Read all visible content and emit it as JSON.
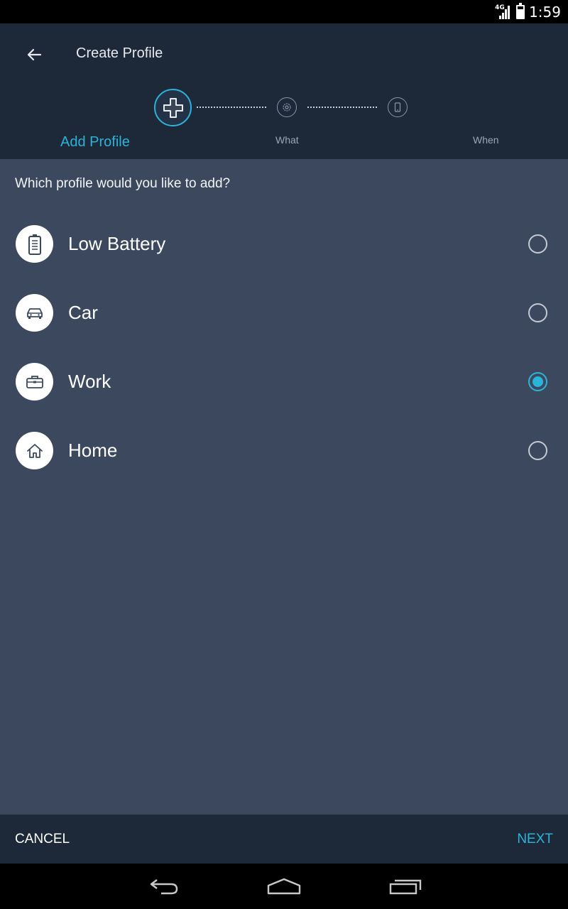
{
  "status_bar": {
    "network": "4G",
    "time": "1:59",
    "icons": [
      "signal-icon",
      "battery-icon"
    ]
  },
  "header": {
    "title": "Create Profile",
    "back_icon": "back-arrow-icon",
    "steps": [
      {
        "label": "Add Profile",
        "icon": "plus-icon",
        "active": true
      },
      {
        "label": "What",
        "icon": "gear-icon",
        "active": false
      },
      {
        "label": "When",
        "icon": "phone-icon",
        "active": false
      }
    ]
  },
  "main": {
    "question": "Which profile would you like to add?",
    "options": [
      {
        "label": "Low Battery",
        "icon": "battery-icon",
        "selected": false
      },
      {
        "label": "Car",
        "icon": "car-icon",
        "selected": false
      },
      {
        "label": "Work",
        "icon": "briefcase-icon",
        "selected": true
      },
      {
        "label": "Home",
        "icon": "home-icon",
        "selected": false
      }
    ]
  },
  "footer": {
    "cancel_label": "CANCEL",
    "next_label": "NEXT"
  },
  "navbar": {
    "icons": [
      "nav-back-icon",
      "nav-home-icon",
      "nav-recents-icon"
    ]
  },
  "colors": {
    "accent": "#2bb4d9",
    "header_bg": "#1d2838",
    "content_bg": "#3b485d"
  }
}
